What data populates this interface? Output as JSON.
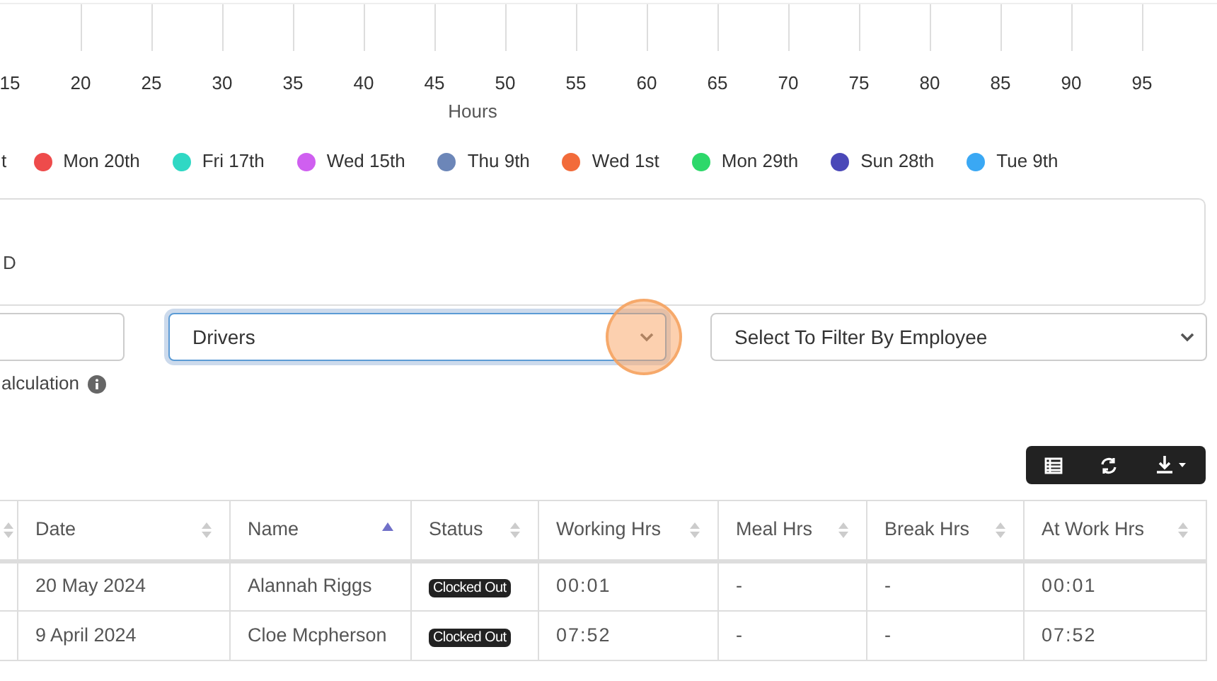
{
  "chart": {
    "x_ticks": [
      "15",
      "20",
      "25",
      "30",
      "35",
      "40",
      "45",
      "50",
      "55",
      "60",
      "65",
      "70",
      "75",
      "80",
      "85",
      "90",
      "95"
    ],
    "x_axis_title": "Hours",
    "legend_cut_text": "t",
    "legend": [
      {
        "label": "Mon 20th",
        "color": "#ee4b4b"
      },
      {
        "label": "Fri 17th",
        "color": "#2fd8c4"
      },
      {
        "label": "Wed 15th",
        "color": "#cf5ff0"
      },
      {
        "label": "Thu 9th",
        "color": "#6c86b8"
      },
      {
        "label": "Wed 1st",
        "color": "#f26b3a"
      },
      {
        "label": "Mon 29th",
        "color": "#2dd86a"
      },
      {
        "label": "Sun 28th",
        "color": "#4a48b8"
      },
      {
        "label": "Tue 9th",
        "color": "#3aa8f4"
      }
    ]
  },
  "panel": {
    "cut_text": "D"
  },
  "filters": {
    "group_select": {
      "value": "Drivers",
      "focused": true
    },
    "employee_select": {
      "value": "Select To Filter By Employee",
      "focused": false
    },
    "cut_label": "alculation"
  },
  "toolbar": [
    {
      "kind": "table"
    },
    {
      "kind": "refresh"
    },
    {
      "kind": "download"
    }
  ],
  "table": {
    "columns": [
      {
        "sorted": false
      },
      {
        "label": "Date",
        "sorted": false
      },
      {
        "label": "Name",
        "sorted": true
      },
      {
        "label": "Status",
        "sorted": false
      },
      {
        "label": "Working Hrs",
        "sorted": false
      },
      {
        "label": "Meal Hrs",
        "sorted": false
      },
      {
        "label": "Break Hrs",
        "sorted": false
      },
      {
        "label": "At Work Hrs",
        "sorted": false
      }
    ],
    "rows": [
      {
        "cells": [
          "",
          "20 May 2024",
          "Alannah Riggs",
          "Clocked Out",
          "00:01",
          "-",
          "-",
          "00:01"
        ]
      },
      {
        "cells": [
          "",
          "9 April 2024",
          "Cloe Mcpherson",
          "Clocked Out",
          "07:52",
          "-",
          "-",
          "07:52"
        ]
      }
    ]
  }
}
